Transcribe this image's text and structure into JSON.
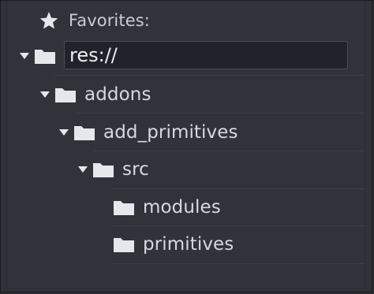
{
  "favorites": {
    "label": "Favorites:",
    "icon": "star-icon"
  },
  "root": {
    "path": "res://",
    "expanded": true
  },
  "tree": [
    {
      "label": "addons",
      "expanded": true,
      "has_arrow": true
    },
    {
      "label": "add_primitives",
      "expanded": true,
      "has_arrow": true
    },
    {
      "label": "src",
      "expanded": true,
      "has_arrow": true
    },
    {
      "label": "modules",
      "expanded": false,
      "has_arrow": false
    },
    {
      "label": "primitives",
      "expanded": false,
      "has_arrow": false
    }
  ],
  "colors": {
    "background": "#31333b",
    "text": "#d7d9de",
    "icon": "#e6e7ea",
    "field_background": "#21232a"
  }
}
